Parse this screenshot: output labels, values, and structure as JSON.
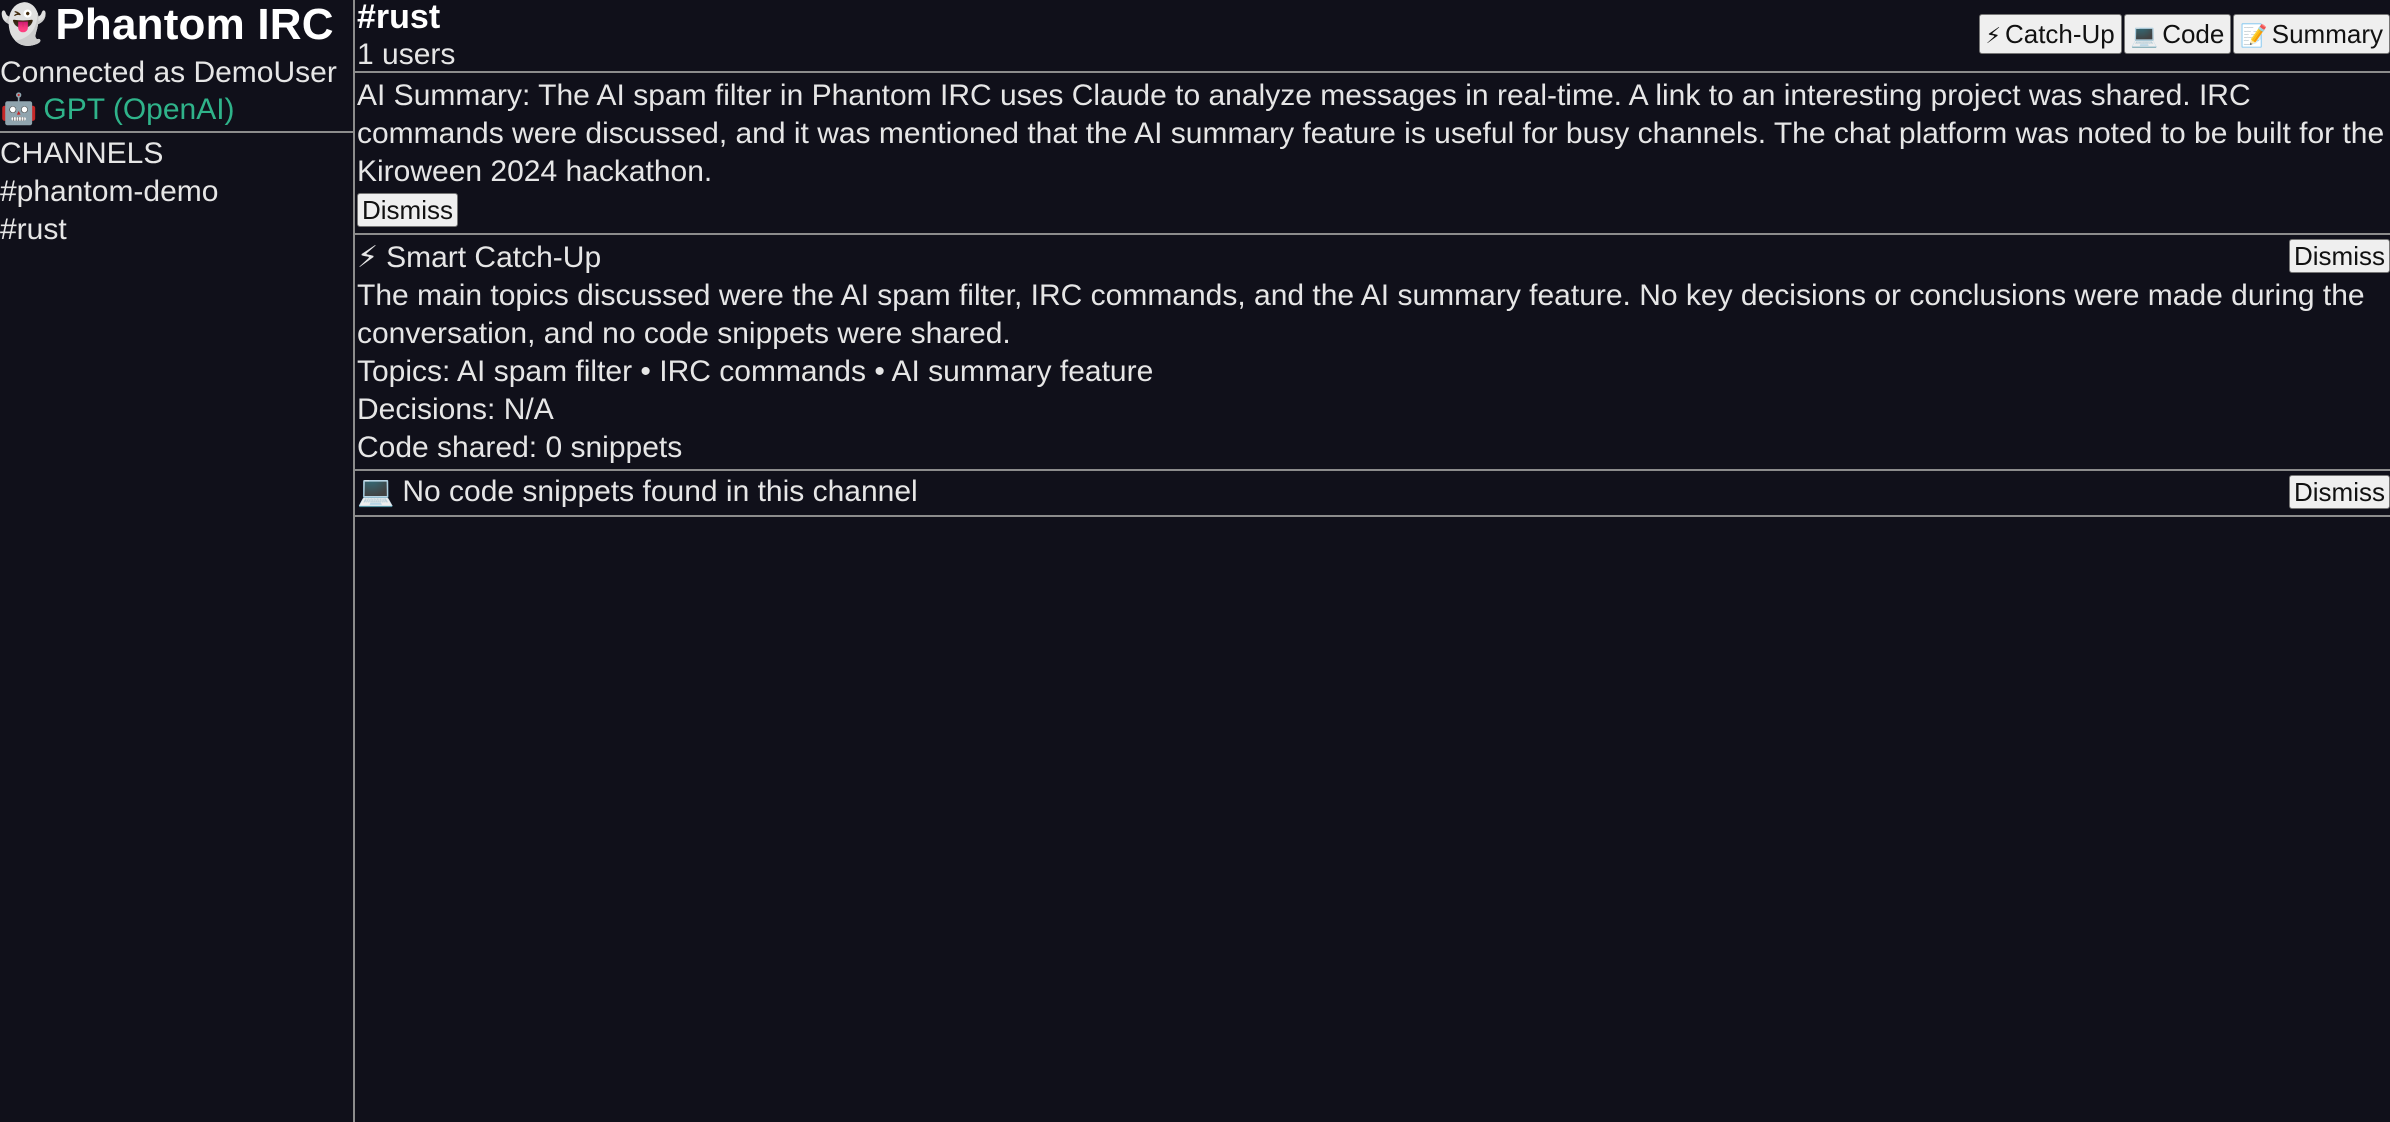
{
  "sidebar": {
    "app_icon": "👻",
    "app_title": "Phantom IRC",
    "connected_as": "Connected as DemoUser",
    "model_icon": "🤖",
    "model_label": "GPT (OpenAI)",
    "channels_header": "CHANNELS",
    "channels": [
      "#phantom-demo",
      "#rust"
    ]
  },
  "header": {
    "channel_name": "#rust",
    "user_count": "1 users",
    "buttons": {
      "catchup_icon": "⚡",
      "catchup_label": "Catch-Up",
      "code_icon": "💻",
      "code_label": "Code",
      "summary_icon": "📝",
      "summary_label": "Summary"
    }
  },
  "summary_panel": {
    "text": "AI Summary: The AI spam filter in Phantom IRC uses Claude to analyze messages in real-time. A link to an interesting project was shared. IRC commands were discussed, and it was mentioned that the AI summary feature is useful for busy channels. The chat platform was noted to be built for the Kiroween 2024 hackathon.",
    "dismiss_label": "Dismiss"
  },
  "catchup_panel": {
    "icon": "⚡",
    "title": "Smart Catch-Up",
    "body": "The main topics discussed were the AI spam filter, IRC commands, and the AI summary feature. No key decisions or conclusions were made during the conversation, and no code snippets were shared.",
    "topics": "Topics: AI spam filter • IRC commands • AI summary feature",
    "decisions": "Decisions: N/A",
    "code_shared": "Code shared: 0 snippets",
    "dismiss_label": "Dismiss"
  },
  "code_panel": {
    "icon": "💻",
    "text": "No code snippets found in this channel",
    "dismiss_label": "Dismiss"
  },
  "colors": {
    "background": "#10101a",
    "accent_green": "#2fb38a",
    "divider": "#8c8c8c"
  }
}
